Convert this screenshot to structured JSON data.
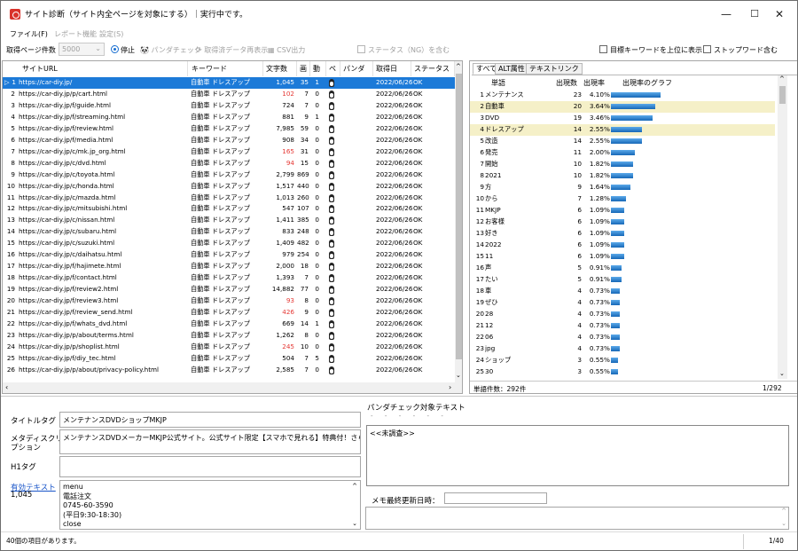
{
  "window": {
    "title": "サイト診断（サイト内全ページを対象にする）｜実行中です。",
    "minimize": "—",
    "maximize": "☐",
    "close": "✕"
  },
  "menu": [
    "ファイル(F)",
    "レポート機能",
    "設定(S)"
  ],
  "toolbar": {
    "pages_label": "取得ページ件数",
    "pages_value": "5000",
    "stop": "停止",
    "panda_check": "パンダチェック",
    "reshow": "取得済データ再表示",
    "csv": "CSV出力",
    "status_ng": "ステータス（NG）を含む",
    "target_kw": "目標キーワードを上位に表示",
    "stopword": "ストップワード含む"
  },
  "grid": {
    "headers": [
      "サイトURL",
      "キーワード",
      "文字数",
      "画",
      "動",
      "ペ",
      "パンダ",
      "取得日",
      "ステータス"
    ],
    "rows": [
      {
        "n": "1",
        "url": "https://car-diy.jp/",
        "kw": "自動車 ドレスアップ",
        "chars": "1,045",
        "img": "35",
        "mov": "1",
        "date": "2022/06/26",
        "st": "OK",
        "red": false
      },
      {
        "n": "2",
        "url": "https://car-diy.jp/p/cart.html",
        "kw": "自動車 ドレスアップ",
        "chars": "102",
        "img": "7",
        "mov": "0",
        "date": "2022/06/26",
        "st": "OK",
        "red": true
      },
      {
        "n": "3",
        "url": "https://car-diy.jp/f/guide.html",
        "kw": "自動車 ドレスアップ",
        "chars": "724",
        "img": "7",
        "mov": "0",
        "date": "2022/06/26",
        "st": "OK",
        "red": false
      },
      {
        "n": "4",
        "url": "https://car-diy.jp/f/streaming.html",
        "kw": "自動車 ドレスアップ",
        "chars": "881",
        "img": "9",
        "mov": "1",
        "date": "2022/06/26",
        "st": "OK",
        "red": false
      },
      {
        "n": "5",
        "url": "https://car-diy.jp/f/review.html",
        "kw": "自動車 ドレスアップ",
        "chars": "7,985",
        "img": "59",
        "mov": "0",
        "date": "2022/06/26",
        "st": "OK",
        "red": false
      },
      {
        "n": "6",
        "url": "https://car-diy.jp/f/media.html",
        "kw": "自動車 ドレスアップ",
        "chars": "908",
        "img": "34",
        "mov": "0",
        "date": "2022/06/26",
        "st": "OK",
        "red": false
      },
      {
        "n": "7",
        "url": "https://car-diy.jp/c/mk.jp_org.html",
        "kw": "自動車 ドレスアップ",
        "chars": "165",
        "img": "31",
        "mov": "0",
        "date": "2022/06/26",
        "st": "OK",
        "red": true
      },
      {
        "n": "8",
        "url": "https://car-diy.jp/c/dvd.html",
        "kw": "自動車 ドレスアップ",
        "chars": "94",
        "img": "15",
        "mov": "0",
        "date": "2022/06/26",
        "st": "OK",
        "red": true
      },
      {
        "n": "9",
        "url": "https://car-diy.jp/c/toyota.html",
        "kw": "自動車 ドレスアップ",
        "chars": "2,799",
        "img": "869",
        "mov": "0",
        "date": "2022/06/26",
        "st": "OK",
        "red": false
      },
      {
        "n": "10",
        "url": "https://car-diy.jp/c/honda.html",
        "kw": "自動車 ドレスアップ",
        "chars": "1,517",
        "img": "440",
        "mov": "0",
        "date": "2022/06/26",
        "st": "OK",
        "red": false
      },
      {
        "n": "11",
        "url": "https://car-diy.jp/c/mazda.html",
        "kw": "自動車 ドレスアップ",
        "chars": "1,013",
        "img": "260",
        "mov": "0",
        "date": "2022/06/26",
        "st": "OK",
        "red": false
      },
      {
        "n": "12",
        "url": "https://car-diy.jp/c/mitsubishi.html",
        "kw": "自動車 ドレスアップ",
        "chars": "547",
        "img": "107",
        "mov": "0",
        "date": "2022/06/26",
        "st": "OK",
        "red": false
      },
      {
        "n": "13",
        "url": "https://car-diy.jp/c/nissan.html",
        "kw": "自動車 ドレスアップ",
        "chars": "1,411",
        "img": "385",
        "mov": "0",
        "date": "2022/06/26",
        "st": "OK",
        "red": false
      },
      {
        "n": "14",
        "url": "https://car-diy.jp/c/subaru.html",
        "kw": "自動車 ドレスアップ",
        "chars": "833",
        "img": "248",
        "mov": "0",
        "date": "2022/06/26",
        "st": "OK",
        "red": false
      },
      {
        "n": "15",
        "url": "https://car-diy.jp/c/suzuki.html",
        "kw": "自動車 ドレスアップ",
        "chars": "1,409",
        "img": "482",
        "mov": "0",
        "date": "2022/06/26",
        "st": "OK",
        "red": false
      },
      {
        "n": "16",
        "url": "https://car-diy.jp/c/daihatsu.html",
        "kw": "自動車 ドレスアップ",
        "chars": "979",
        "img": "254",
        "mov": "0",
        "date": "2022/06/26",
        "st": "OK",
        "red": false
      },
      {
        "n": "17",
        "url": "https://car-diy.jp/f/hajimete.html",
        "kw": "自動車 ドレスアップ",
        "chars": "2,000",
        "img": "18",
        "mov": "0",
        "date": "2022/06/26",
        "st": "OK",
        "red": false
      },
      {
        "n": "18",
        "url": "https://car-diy.jp/f/contact.html",
        "kw": "自動車 ドレスアップ",
        "chars": "1,393",
        "img": "7",
        "mov": "0",
        "date": "2022/06/26",
        "st": "OK",
        "red": false
      },
      {
        "n": "19",
        "url": "https://car-diy.jp/f/review2.html",
        "kw": "自動車 ドレスアップ",
        "chars": "14,882",
        "img": "77",
        "mov": "0",
        "date": "2022/06/26",
        "st": "OK",
        "red": false
      },
      {
        "n": "20",
        "url": "https://car-diy.jp/f/review3.html",
        "kw": "自動車 ドレスアップ",
        "chars": "93",
        "img": "8",
        "mov": "0",
        "date": "2022/06/26",
        "st": "OK",
        "red": true
      },
      {
        "n": "21",
        "url": "https://car-diy.jp/f/review_send.html",
        "kw": "自動車 ドレスアップ",
        "chars": "426",
        "img": "9",
        "mov": "0",
        "date": "2022/06/26",
        "st": "OK",
        "red": true
      },
      {
        "n": "22",
        "url": "https://car-diy.jp/f/whats_dvd.html",
        "kw": "自動車 ドレスアップ",
        "chars": "669",
        "img": "14",
        "mov": "1",
        "date": "2022/06/26",
        "st": "OK",
        "red": false
      },
      {
        "n": "23",
        "url": "https://car-diy.jp/p/about/terms.html",
        "kw": "自動車 ドレスアップ",
        "chars": "1,262",
        "img": "8",
        "mov": "0",
        "date": "2022/06/26",
        "st": "OK",
        "red": false
      },
      {
        "n": "24",
        "url": "https://car-diy.jp/p/shoplist.html",
        "kw": "自動車 ドレスアップ",
        "chars": "245",
        "img": "10",
        "mov": "0",
        "date": "2022/06/26",
        "st": "OK",
        "red": true
      },
      {
        "n": "25",
        "url": "https://car-diy.jp/f/diy_tec.html",
        "kw": "自動車 ドレスアップ",
        "chars": "504",
        "img": "7",
        "mov": "5",
        "date": "2022/06/26",
        "st": "OK",
        "red": false
      },
      {
        "n": "26",
        "url": "https://car-diy.jp/p/about/privacy-policy.html",
        "kw": "自動車 ドレスアップ",
        "chars": "2,585",
        "img": "7",
        "mov": "0",
        "date": "2022/06/26",
        "st": "OK",
        "red": false
      }
    ]
  },
  "words": {
    "tabs": [
      "すべて",
      "ALT属性",
      "テキストリンク"
    ],
    "headers": [
      "単語",
      "出現数",
      "出現率",
      "出現率のグラフ"
    ],
    "rows": [
      {
        "n": "1",
        "w": "メンテナンス",
        "c": "23",
        "p": "4.10%",
        "v": 4.1
      },
      {
        "n": "2",
        "w": "自動車",
        "c": "20",
        "p": "3.64%",
        "v": 3.64,
        "hl": true
      },
      {
        "n": "3",
        "w": "DVD",
        "c": "19",
        "p": "3.46%",
        "v": 3.46
      },
      {
        "n": "4",
        "w": "ドレスアップ",
        "c": "14",
        "p": "2.55%",
        "v": 2.55,
        "hl": true
      },
      {
        "n": "5",
        "w": "改造",
        "c": "14",
        "p": "2.55%",
        "v": 2.55
      },
      {
        "n": "6",
        "w": "発売",
        "c": "11",
        "p": "2.00%",
        "v": 2.0
      },
      {
        "n": "7",
        "w": "開始",
        "c": "10",
        "p": "1.82%",
        "v": 1.82
      },
      {
        "n": "8",
        "w": "2021",
        "c": "10",
        "p": "1.82%",
        "v": 1.82
      },
      {
        "n": "9",
        "w": "方",
        "c": "9",
        "p": "1.64%",
        "v": 1.64
      },
      {
        "n": "10",
        "w": "から",
        "c": "7",
        "p": "1.28%",
        "v": 1.28
      },
      {
        "n": "11",
        "w": "MKJP",
        "c": "6",
        "p": "1.09%",
        "v": 1.09
      },
      {
        "n": "12",
        "w": "お客様",
        "c": "6",
        "p": "1.09%",
        "v": 1.09
      },
      {
        "n": "13",
        "w": "好き",
        "c": "6",
        "p": "1.09%",
        "v": 1.09
      },
      {
        "n": "14",
        "w": "2022",
        "c": "6",
        "p": "1.09%",
        "v": 1.09
      },
      {
        "n": "15",
        "w": "11",
        "c": "6",
        "p": "1.09%",
        "v": 1.09
      },
      {
        "n": "16",
        "w": "声",
        "c": "5",
        "p": "0.91%",
        "v": 0.91
      },
      {
        "n": "17",
        "w": "たい",
        "c": "5",
        "p": "0.91%",
        "v": 0.91
      },
      {
        "n": "18",
        "w": "車",
        "c": "4",
        "p": "0.73%",
        "v": 0.73
      },
      {
        "n": "19",
        "w": "ぜひ",
        "c": "4",
        "p": "0.73%",
        "v": 0.73
      },
      {
        "n": "20",
        "w": "28",
        "c": "4",
        "p": "0.73%",
        "v": 0.73
      },
      {
        "n": "21",
        "w": "12",
        "c": "4",
        "p": "0.73%",
        "v": 0.73
      },
      {
        "n": "22",
        "w": "06",
        "c": "4",
        "p": "0.73%",
        "v": 0.73
      },
      {
        "n": "23",
        "w": "jpg",
        "c": "4",
        "p": "0.73%",
        "v": 0.73
      },
      {
        "n": "24",
        "w": "ショップ",
        "c": "3",
        "p": "0.55%",
        "v": 0.55
      },
      {
        "n": "25",
        "w": "30",
        "c": "3",
        "p": "0.55%",
        "v": 0.55
      }
    ],
    "count_label": "単語件数：292件",
    "page": "1/292"
  },
  "detail": {
    "title_label": "タイトルタグ",
    "title_value": "メンテナンスDVDショップMKJP",
    "meta_label1": "メタディスクリ",
    "meta_label2": "プション",
    "meta_value": "メンテナンスDVDメーカーMKJP公式サイト。公式サイト限定【スマホで見れる】特典付！さらに送料無料",
    "h1_label": "H1タグ",
    "text_label": "有効テキスト",
    "text_count": "1,045",
    "text_lines": [
      "menu",
      "電話注文",
      "0745-60-3590",
      "(平日9:30-18:30)",
      "close"
    ]
  },
  "panda": {
    "label": "パンダチェック対象テキスト",
    "placeholder": "<<未調査>>",
    "memo_label": "メモ最終更新日時："
  },
  "status": {
    "left": "40個の項目があります。",
    "right": "1/40"
  }
}
